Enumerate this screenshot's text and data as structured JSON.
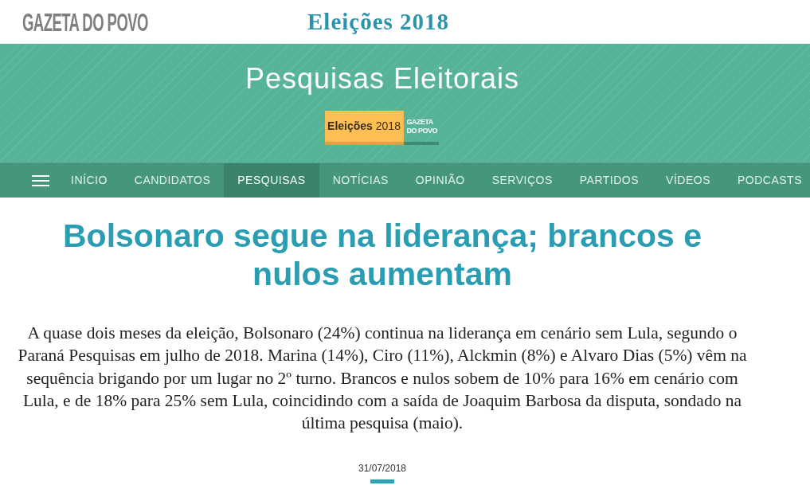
{
  "header": {
    "logo": "GAZETA DO POVO",
    "section_title": "Eleições 2018"
  },
  "banner": {
    "title": "Pesquisas Eleitorais",
    "badge": {
      "label": "**Eleições** 2018",
      "logo_lines": [
        "GAZETA",
        "DO POVO"
      ]
    }
  },
  "nav": {
    "items": [
      {
        "label": "INÍCIO",
        "selected": false
      },
      {
        "label": "CANDIDATOS",
        "selected": false
      },
      {
        "label": "PESQUISAS",
        "selected": true
      },
      {
        "label": "NOTÍCIAS",
        "selected": false
      },
      {
        "label": "OPINIÃO",
        "selected": false
      },
      {
        "label": "SERVIÇOS",
        "selected": false
      },
      {
        "label": "PARTIDOS",
        "selected": false
      },
      {
        "label": "VÍDEOS",
        "selected": false
      },
      {
        "label": "PODCASTS",
        "selected": false
      }
    ]
  },
  "article": {
    "headline": "Bolsonaro segue na liderança; brancos e nulos aumentam",
    "summary": "A quase dois meses da eleição, Bolsonaro (24%) continua na liderança em cenário sem Lula, segundo o Paraná Pesquisas em julho de 2018. Marina (14%), Ciro (11%), Alckmin (8%) e Alvaro Dias (5%) vêm na sequência brigando por um lugar no 2º turno. Brancos e nulos sobem de 10% para 16% em cenário com Lula, e de 18% para 25% sem Lula, coincidindo com a saída de Joaquim Barbosa da disputa, sondado na última pesquisa (maio).",
    "date": "31/07/2018"
  }
}
